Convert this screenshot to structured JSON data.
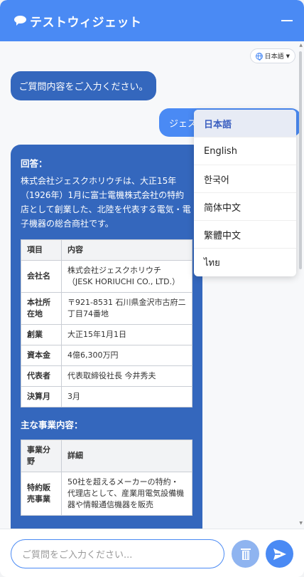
{
  "header": {
    "title": "テストウィジェット"
  },
  "language": {
    "current": "日本語",
    "options": [
      {
        "label": "日本語",
        "active": true
      },
      {
        "label": "English"
      },
      {
        "label": "한국어"
      },
      {
        "label": "简体中文"
      },
      {
        "label": "繁體中文"
      },
      {
        "label": "ไทย"
      }
    ]
  },
  "messages": {
    "bot_prompt": "ご質問内容をご入力ください。",
    "user_message": "ジェスクホリウチ",
    "answer": {
      "label": "回答：",
      "intro": "株式会社ジェスクホリウチは、大正15年（1926年）1月に富士電機株式会社の特約店として創業した、北陸を代表する電気・電子機器の総合商社です。",
      "table1": {
        "headers": [
          "項目",
          "内容"
        ],
        "rows": [
          [
            "会社名",
            "株式会社ジェスクホリウチ（JESK HORIUCHI CO., LTD.）"
          ],
          [
            "本社所在地",
            "〒921-8531 石川県金沢市古府二丁目74番地"
          ],
          [
            "創業",
            "大正15年1月1日"
          ],
          [
            "資本金",
            "4億6,300万円"
          ],
          [
            "代表者",
            "代表取締役社長 今井秀夫"
          ],
          [
            "決算月",
            "3月"
          ]
        ]
      },
      "section_label": "主な事業内容：",
      "table2": {
        "headers": [
          "事業分野",
          "詳細"
        ],
        "rows": [
          [
            "特約販売事業",
            "50社を超えるメーカーの特約・代理店として、産業用電気設備機器や情報通信機器を販売"
          ]
        ]
      }
    }
  },
  "input": {
    "placeholder": "ご質問をご入力ください..."
  },
  "colors": {
    "primary": "#4a8af4",
    "bubble": "#3467bd"
  }
}
